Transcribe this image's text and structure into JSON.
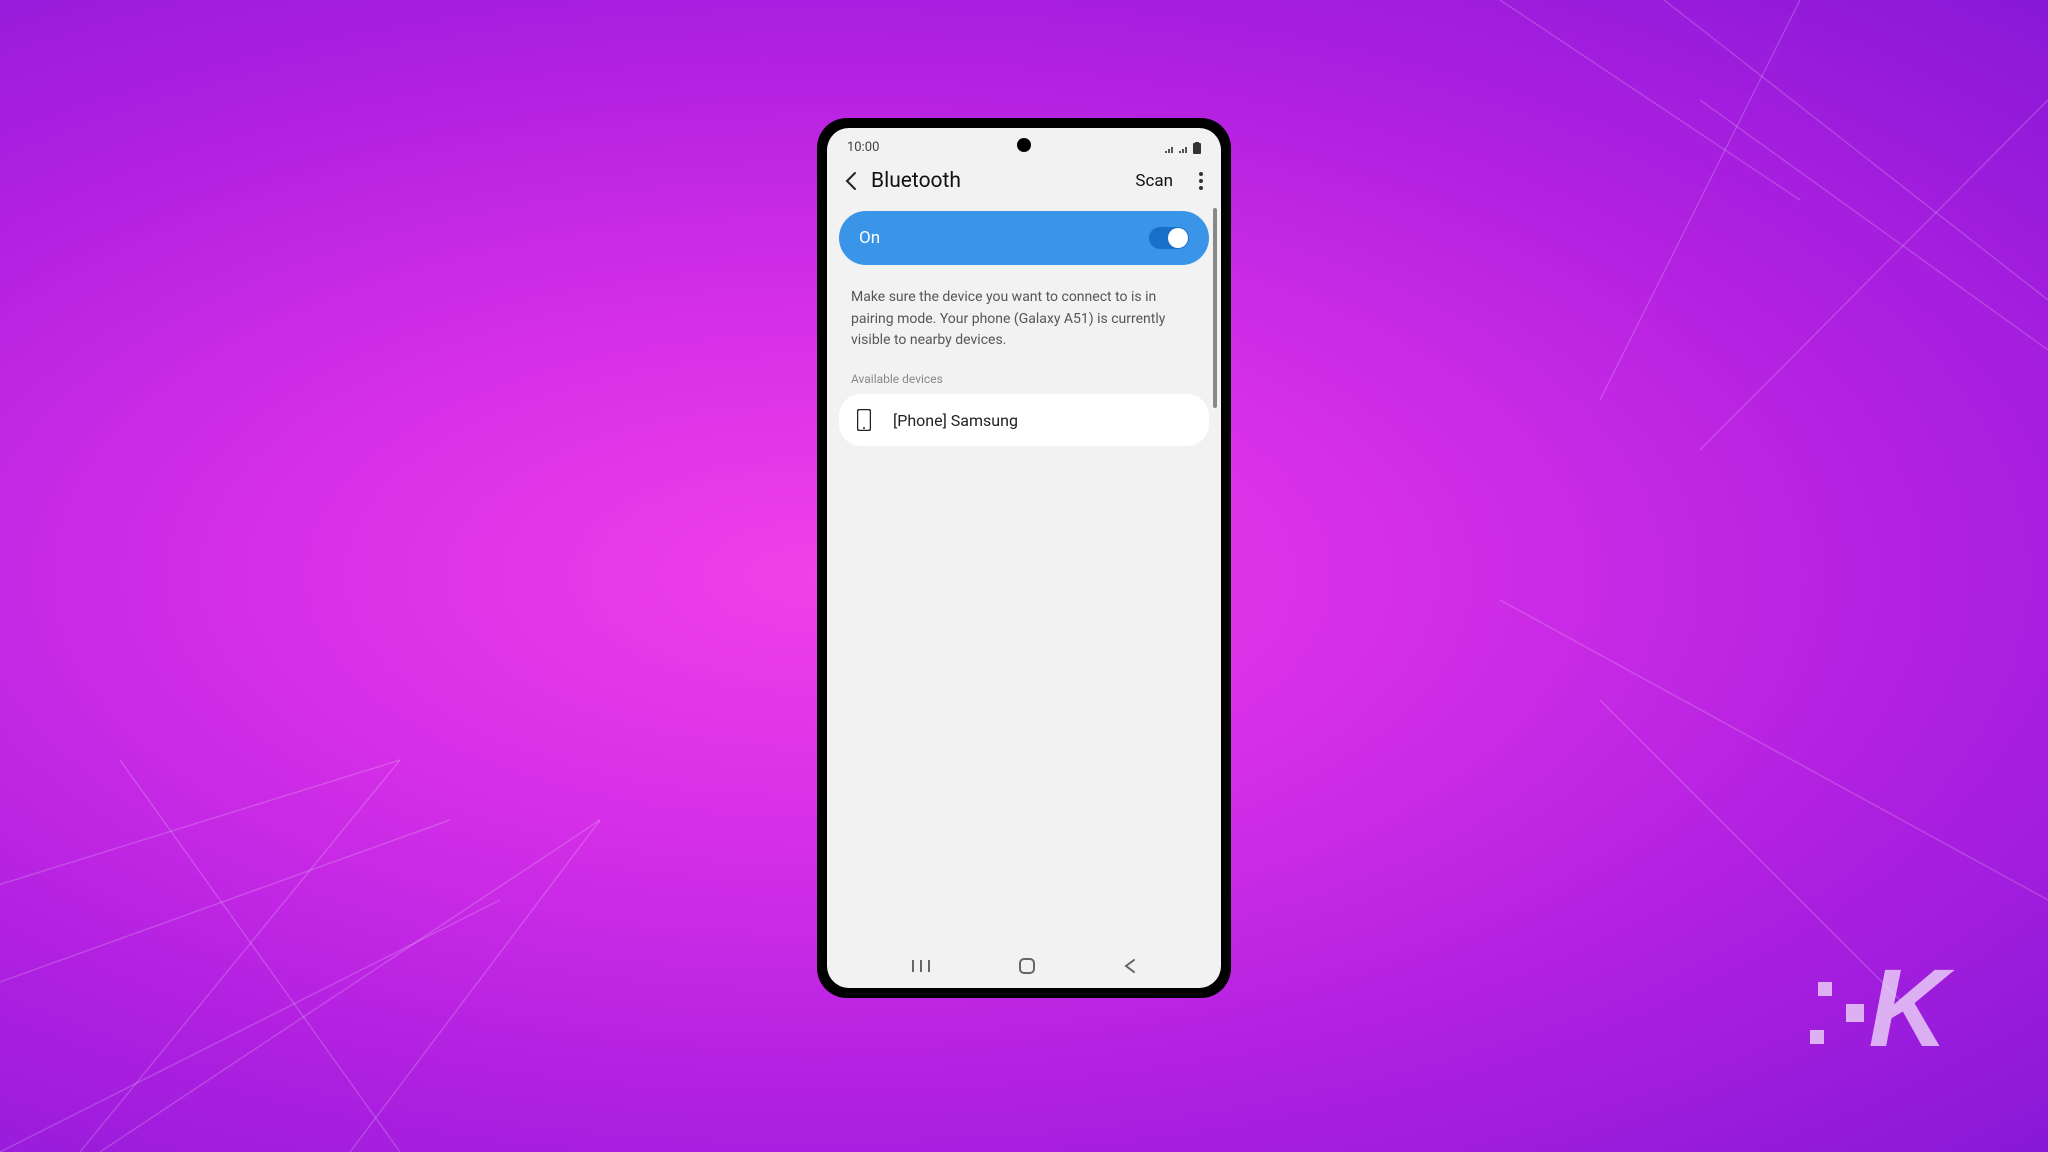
{
  "statusBar": {
    "time": "10:00"
  },
  "header": {
    "title": "Bluetooth",
    "scanLabel": "Scan"
  },
  "toggle": {
    "label": "On",
    "state": true
  },
  "infoText": "Make sure the device you want to connect to is in pairing mode. Your phone (Galaxy A51) is currently visible to nearby devices.",
  "sectionLabel": "Available devices",
  "devices": [
    {
      "name": "[Phone] Samsung",
      "iconType": "phone"
    }
  ]
}
